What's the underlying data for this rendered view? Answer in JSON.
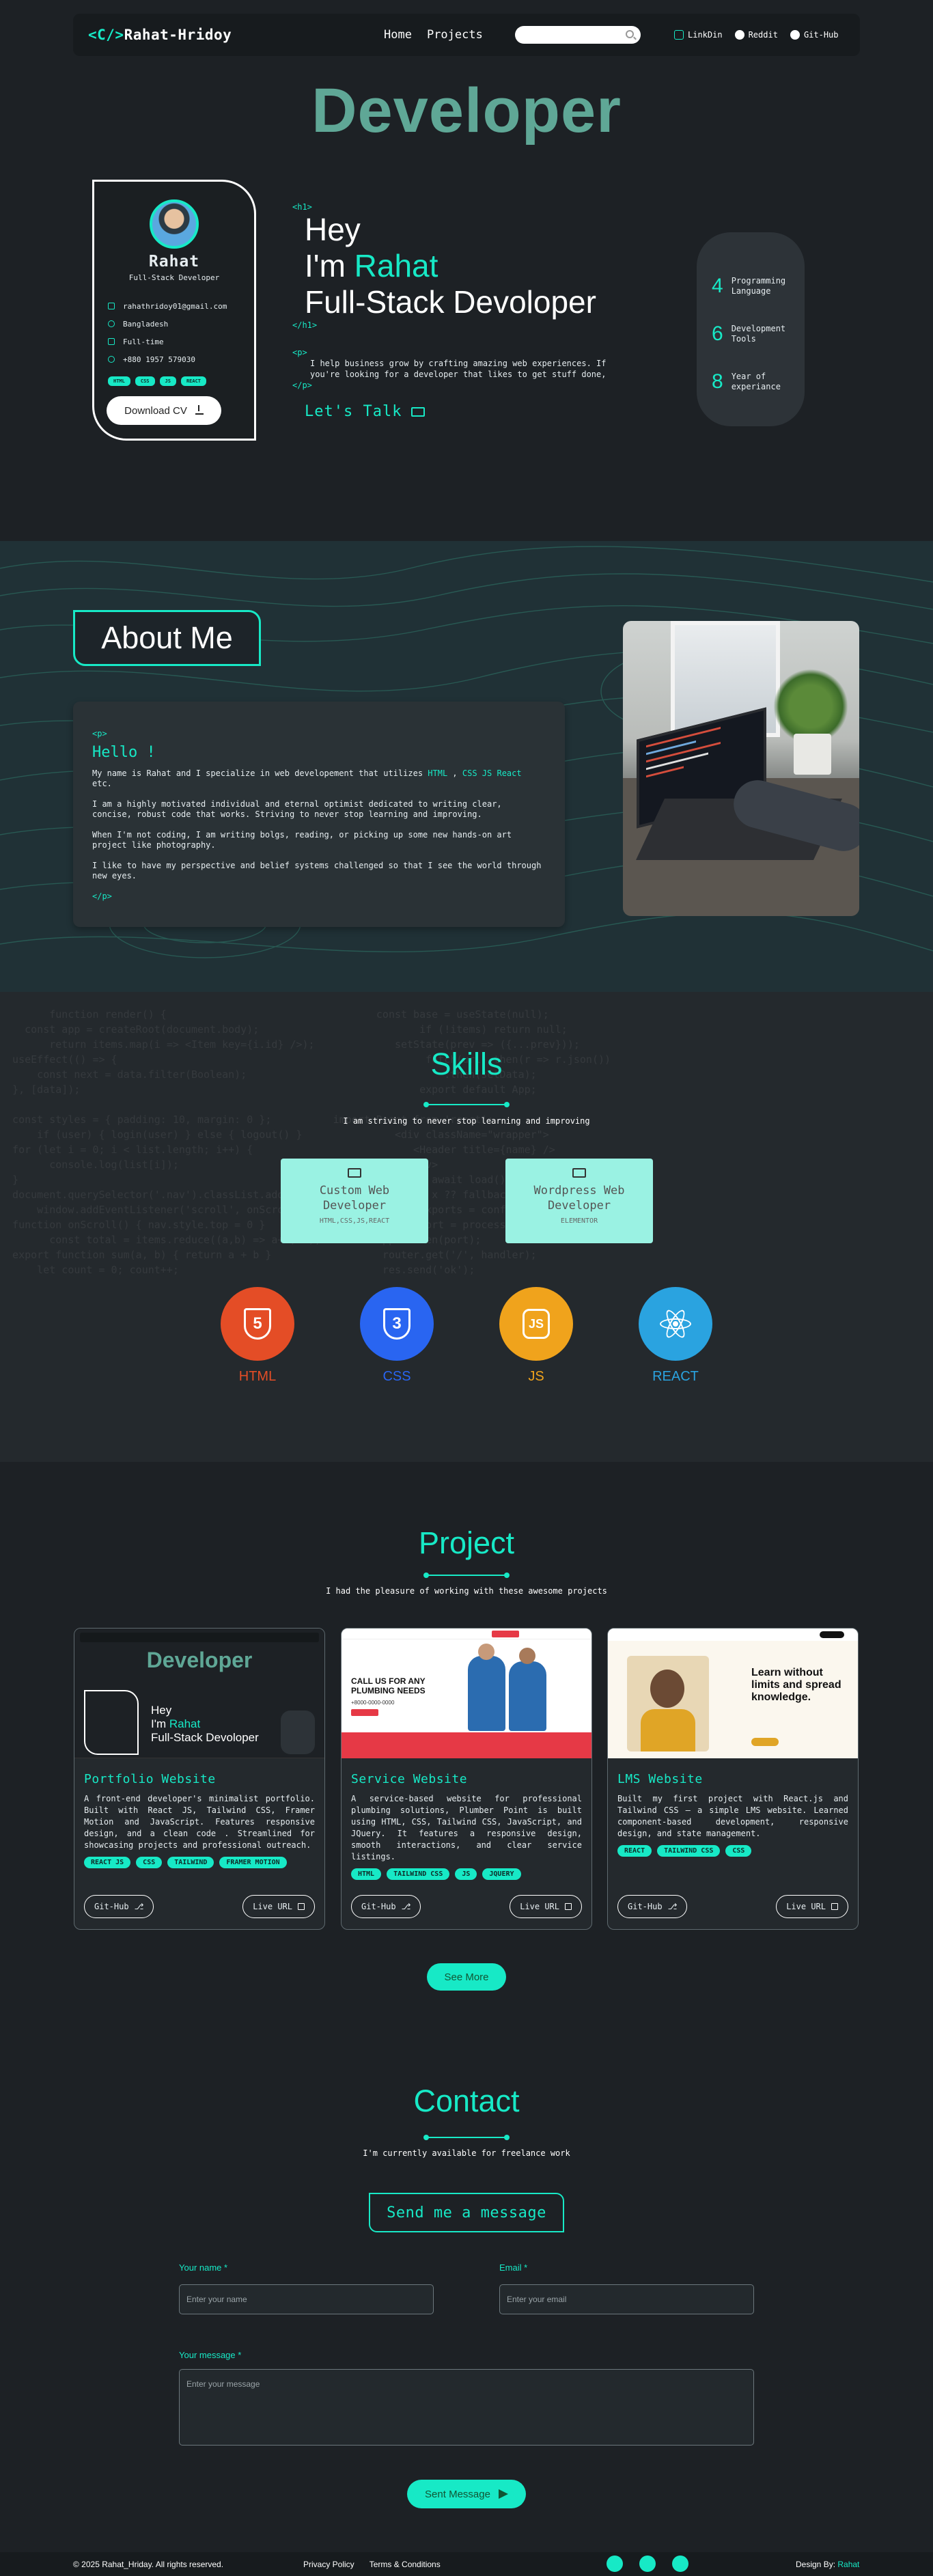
{
  "nav": {
    "logo_tag": "<C/>",
    "logo_name": "Rahat-Hridoy",
    "links": [
      "Home",
      "Projects"
    ],
    "search_placeholder": "",
    "social": [
      "LinkDin",
      "Reddit",
      "Git-Hub"
    ]
  },
  "hero": {
    "big_title": "Developer",
    "card": {
      "name": "Rahat",
      "role": "Full-Stack Developer",
      "email": "rahathridoy01@gmail.com",
      "location": "Bangladesh",
      "type": "Full-time",
      "phone": "+880 1957 579030",
      "chips": [
        "HTML",
        "CSS",
        "JS",
        "REACT"
      ],
      "download": "Download CV"
    },
    "h1_open": "<h1>",
    "h1_close": "</h1>",
    "line1": "Hey",
    "line2_prefix": "I'm ",
    "line2_name": "Rahat",
    "line3": "Full-Stack Devoloper",
    "p_open": "<p>",
    "p_close": "</p>",
    "paragraph": "I help business grow by crafting amazing web experiences. If you're looking for a developer that likes to get stuff done,",
    "cta": "Let's Talk",
    "stats": [
      {
        "num": "4",
        "label": "Programming Language"
      },
      {
        "num": "6",
        "label": "Development Tools"
      },
      {
        "num": "8",
        "label": "Year of experiance"
      }
    ]
  },
  "about": {
    "title": "About Me",
    "p_open": "<p>",
    "p_close": "</p>",
    "hello": "Hello !",
    "intro_pre": "My name is Rahat and I specialize in web developement that utilizes ",
    "intro_html": "HTML",
    "intro_mid": " , ",
    "intro_css": "CSS",
    "intro_js": " JS",
    "intro_react": " React",
    "intro_post": " etc.",
    "para2": "I am a highly motivated individual and eternal optimist dedicated to writing clear, concise, robust code that works. Striving to never stop learning and improving.",
    "para3": "When I'm not coding, I am writing bolgs, reading, or picking up some new hands-on art project like photography.",
    "para4": "I like to have my perspective and belief systems challenged so that I see the world through new eyes."
  },
  "skills": {
    "title": "Skills",
    "subtitle": "I am striving to never stop learning and improving",
    "services": [
      {
        "title": "Custom Web Developer",
        "sub": "HTML,CSS,JS,REACT"
      },
      {
        "title": "Wordpress Web Developer",
        "sub": "ELEMENTOR"
      }
    ],
    "tech": [
      {
        "label": "HTML",
        "glyph": "5",
        "color": "#e44d26"
      },
      {
        "label": "CSS",
        "glyph": "3",
        "color": "#2965f1"
      },
      {
        "label": "JS",
        "glyph": "JS",
        "color": "#f0a31c"
      },
      {
        "label": "REACT",
        "glyph": "",
        "color": "#2aa3e0"
      }
    ]
  },
  "projects": {
    "title": "Project",
    "subtitle": "I had the pleasure of working with these awesome projects",
    "items": [
      {
        "title": "Portfolio Website",
        "desc": "A front-end developer's minimalist portfolio. Built with React JS, Tailwind CSS, Framer Motion and JavaScript. Features responsive design, and a clean code . Streamlined for showcasing projects and professional outreach.",
        "tags": [
          "REACT JS",
          "CSS",
          "TAILWIND",
          "FRAMER MOTION"
        ],
        "btn1": "Git-Hub",
        "btn2": "Live URL",
        "shot_title": "Developer",
        "shot_line1": "Hey",
        "shot_line2a": "I'm ",
        "shot_line2b": "Rahat",
        "shot_line3": "Full-Stack Devoloper"
      },
      {
        "title": "Service Website",
        "desc": "A service-based website for professional plumbing solutions, Plumber Point is built using HTML, CSS, Tailwind CSS, JavaScript, and JQuery. It features a responsive design, smooth interactions, and clear service listings.",
        "tags": [
          "HTML",
          "TAILWIND CSS",
          "JS",
          "JQUERY"
        ],
        "btn1": "Git-Hub",
        "btn2": "Live URL",
        "shot_title": "CALL US FOR ANY PLUMBING NEEDS",
        "shot_phone": "+8000-0000-0000"
      },
      {
        "title": "LMS Website",
        "desc": "Built my first project with React.js and Tailwind CSS — a simple LMS website. Learned component-based development, responsive design, and state management.",
        "tags": [
          "REACT",
          "TAILWIND CSS",
          "CSS"
        ],
        "btn1": "Git-Hub",
        "btn2": "Live URL",
        "shot_title": "Learn without limits and spread knowledge."
      }
    ],
    "see_more": "See More"
  },
  "contact": {
    "title": "Contact",
    "subtitle": "I'm currently available for freelance work",
    "send_box": "Send me a message",
    "name_label": "Your name *",
    "name_placeholder": "Enter your name",
    "email_label": "Email *",
    "email_placeholder": "Enter your email",
    "message_label": "Your message *",
    "message_placeholder": "Enter your message",
    "submit": "Sent Message"
  },
  "footer": {
    "copyright": "© 2025 Rahat_Hriday. All rights reserved.",
    "links": [
      "Privacy Policy",
      "Terms & Conditions"
    ],
    "design_prefix": "Design By: ",
    "design_name": "Rahat"
  },
  "colors": {
    "accent": "#17e9c6",
    "bg": "#1d2125",
    "nav": "#171b1e"
  }
}
